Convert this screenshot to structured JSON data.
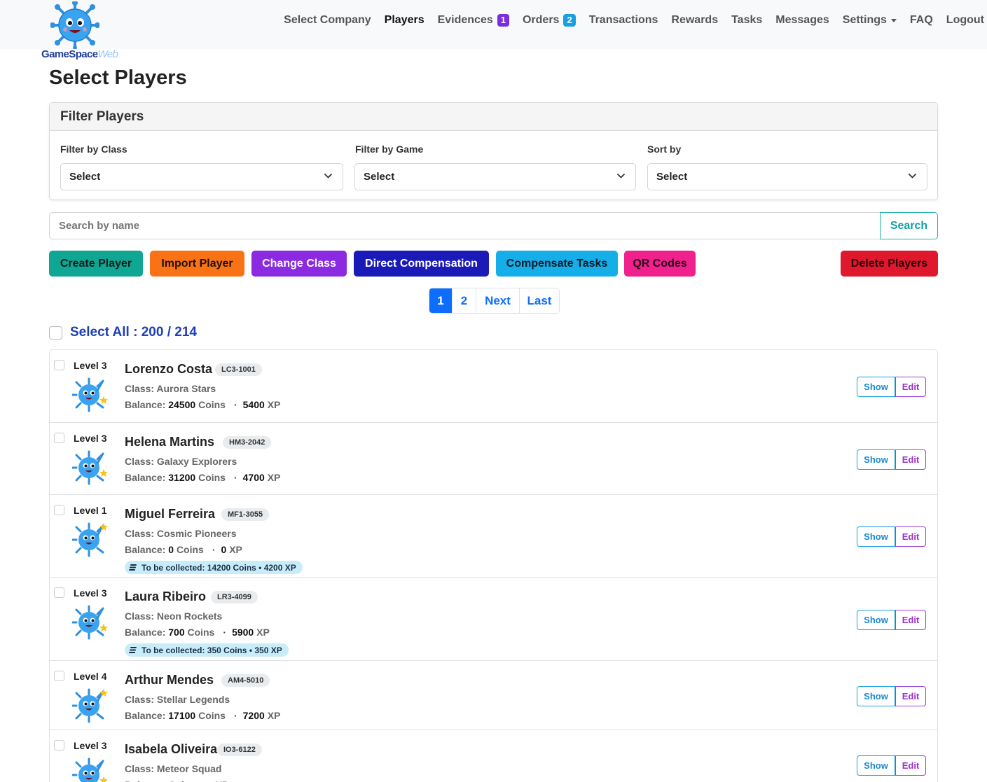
{
  "brand": {
    "name_main": "GameSpace",
    "name_suffix": "Web"
  },
  "nav": {
    "items": [
      {
        "label": "Select Company",
        "active": false
      },
      {
        "label": "Players",
        "active": true
      },
      {
        "label": "Evidences",
        "badge": "1",
        "badge_color": "#7b2ee0"
      },
      {
        "label": "Orders",
        "badge": "2",
        "badge_color": "#1aa0e0"
      },
      {
        "label": "Transactions"
      },
      {
        "label": "Rewards"
      },
      {
        "label": "Tasks"
      },
      {
        "label": "Messages"
      },
      {
        "label": "Settings",
        "dropdown": true
      },
      {
        "label": "FAQ"
      },
      {
        "label": "Logout"
      }
    ]
  },
  "page": {
    "title": "Select Players"
  },
  "filters": {
    "header": "Filter Players",
    "by_class": {
      "label": "Filter by Class",
      "value": "Select"
    },
    "by_game": {
      "label": "Filter by Game",
      "value": "Select"
    },
    "sort_by": {
      "label": "Sort by",
      "value": "Select"
    }
  },
  "search": {
    "placeholder": "Search by name",
    "button": "Search"
  },
  "actions": {
    "create": {
      "label": "Create Player",
      "bg": "#0fa693",
      "fg": "#0b1f1c"
    },
    "import": {
      "label": "Import Player",
      "bg": "#f97316",
      "fg": "#241004"
    },
    "change_class": {
      "label": "Change Class",
      "bg": "#8b2ae0",
      "fg": "#ffffff"
    },
    "direct_comp": {
      "label": "Direct Compensation",
      "bg": "#1a1ab8",
      "fg": "#ffffff"
    },
    "comp_tasks": {
      "label": "Compensate Tasks",
      "bg": "#15aee8",
      "fg": "#081b28"
    },
    "qr_codes": {
      "label": "QR Codes",
      "bg": "#f0208c",
      "fg": "#2a0418"
    },
    "delete": {
      "label": "Delete Players",
      "bg": "#e0182e",
      "fg": "#2a0308"
    }
  },
  "pagination": {
    "pages": [
      "1",
      "2"
    ],
    "current": "1",
    "next": "Next",
    "last": "Last"
  },
  "select_all": {
    "label": "Select All : 200 / 214"
  },
  "labels": {
    "class_prefix": "Class:",
    "balance_prefix": "Balance:",
    "coins": "Coins",
    "xp": "XP",
    "show": "Show",
    "edit": "Edit"
  },
  "players": [
    {
      "level": "Level 3",
      "name": "Lorenzo Costa",
      "code": "LC3-1001",
      "class": "Aurora Stars",
      "coins": "24500",
      "xp": "5400"
    },
    {
      "level": "Level 3",
      "name": "Helena Martins",
      "code": "HM3-2042",
      "class": "Galaxy Explorers",
      "coins": "31200",
      "xp": "4700"
    },
    {
      "level": "Level 1",
      "name": "Miguel Ferreira",
      "code": "MF1-3055",
      "class": "Cosmic Pioneers",
      "coins": "0",
      "xp": "0",
      "to_collect": "To be collected: 14200 Coins • 4200 XP"
    },
    {
      "level": "Level 3",
      "name": "Laura Ribeiro",
      "code": "LR3-4099",
      "class": "Neon Rockets",
      "coins": "700",
      "xp": "5900",
      "to_collect": "To be collected: 350 Coins • 350 XP"
    },
    {
      "level": "Level 4",
      "name": "Arthur Mendes",
      "code": "AM4-5010",
      "class": "Stellar Legends",
      "coins": "17100",
      "xp": "7200"
    },
    {
      "level": "Level 3",
      "name": "Isabela Oliveira",
      "code": "IO3-6122",
      "class": "Meteor Squad",
      "coins": "",
      "xp": ""
    }
  ]
}
